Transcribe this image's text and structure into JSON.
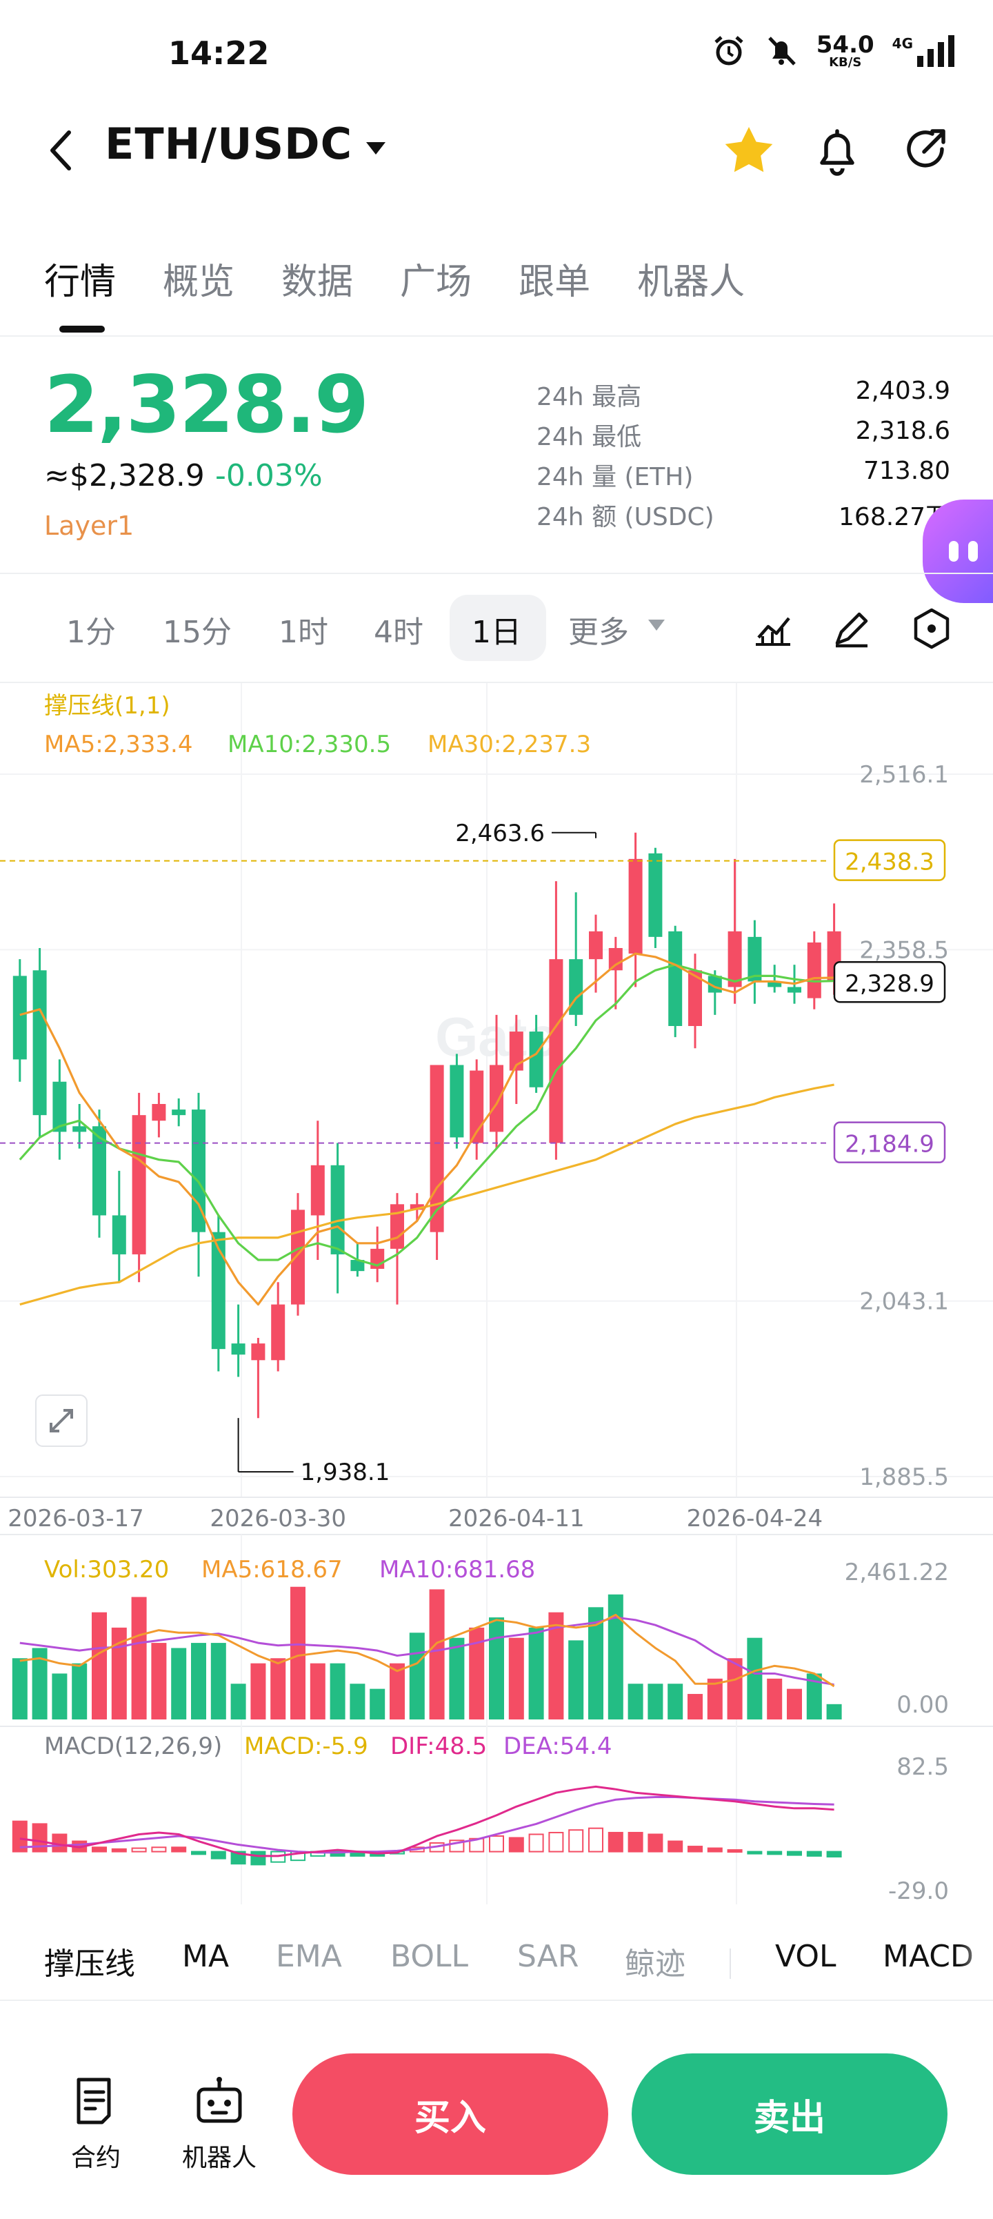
{
  "status_bar": {
    "time": "14:22",
    "net_speed": "54.0",
    "net_unit": "KB/S",
    "network": "4G"
  },
  "header": {
    "pair": "ETH/USDC",
    "favorited": true
  },
  "tabs": [
    {
      "label": "行情",
      "active": true
    },
    {
      "label": "概览",
      "active": false
    },
    {
      "label": "数据",
      "active": false
    },
    {
      "label": "广场",
      "active": false
    },
    {
      "label": "跟单",
      "active": false
    },
    {
      "label": "机器人",
      "active": false
    }
  ],
  "price": {
    "last": "2,328.9",
    "usd": "≈$2,328.9",
    "change": "-0.03%",
    "tag": "Layer1"
  },
  "stats": [
    {
      "label": "24h  最高",
      "value": "2,403.9"
    },
    {
      "label": "24h  最低",
      "value": "2,318.6"
    },
    {
      "label": "24h  量 (ETH)",
      "value": "713.80"
    },
    {
      "label": "24h  额 (USDC)",
      "value": "168.27万"
    }
  ],
  "timeframes": [
    {
      "label": "1分",
      "active": false
    },
    {
      "label": "15分",
      "active": false
    },
    {
      "label": "1时",
      "active": false
    },
    {
      "label": "4时",
      "active": false
    },
    {
      "label": "1日",
      "active": true
    }
  ],
  "more_label": "更多",
  "colors": {
    "up": "#f44d64",
    "down": "#23bd84",
    "price_green": "#1fb77a",
    "ma5": "#f29a2e",
    "ma10": "#5ed14a",
    "ma30": "#f2b42a",
    "vol_ma10": "#b44fd8",
    "support": "#9b4dc4",
    "resistance": "#e0b400"
  },
  "chart_data": [
    {
      "type": "candlestick",
      "legend": {
        "sr": "撑压线(1,1)",
        "ma5": "MA5:2,333.4",
        "ma10": "MA10:2,330.5",
        "ma30": "MA30:2,237.3"
      },
      "y_ticks": [
        "2,516.1",
        "2,358.5",
        "2,043.1",
        "1,885.5"
      ],
      "y_tick_values": [
        2516.1,
        2358.5,
        2043.1,
        1885.5
      ],
      "ylim": [
        1885.5,
        2516.1
      ],
      "x_labels": [
        "2026-03-17",
        "2026-03-30",
        "2026-04-11",
        "2026-04-24"
      ],
      "x_label_index": [
        0,
        13,
        25,
        37
      ],
      "current_price": "2,328.9",
      "current_value": 2328.9,
      "resistance": "2,438.3",
      "resistance_value": 2438.3,
      "support": "2,184.9",
      "support_value": 2184.9,
      "max_label": "2,463.6",
      "max_index": 29,
      "max_value": 2463.6,
      "min_label": "1,938.1",
      "min_index": 11,
      "min_value": 1938.1,
      "first_index": -1,
      "candles": [
        [
          2335,
          2350,
          2240,
          2260
        ],
        [
          2340,
          2360,
          2190,
          2210
        ],
        [
          2240,
          2260,
          2170,
          2195
        ],
        [
          2200,
          2220,
          2180,
          2195
        ],
        [
          2200,
          2215,
          2100,
          2120
        ],
        [
          2120,
          2160,
          2060,
          2085
        ],
        [
          2085,
          2230,
          2060,
          2210
        ],
        [
          2205,
          2230,
          2190,
          2220
        ],
        [
          2215,
          2225,
          2200,
          2210
        ],
        [
          2215,
          2230,
          2065,
          2105
        ],
        [
          2105,
          2120,
          1980,
          2000
        ],
        [
          2005,
          2040,
          1975,
          1995
        ],
        [
          1990,
          2010,
          1938,
          2005
        ],
        [
          1990,
          2060,
          1980,
          2040
        ],
        [
          2040,
          2140,
          2030,
          2125
        ],
        [
          2120,
          2205,
          2080,
          2165
        ],
        [
          2165,
          2185,
          2050,
          2085
        ],
        [
          2080,
          2095,
          2065,
          2070
        ],
        [
          2072,
          2110,
          2060,
          2090
        ],
        [
          2090,
          2140,
          2040,
          2130
        ],
        [
          2125,
          2140,
          2115,
          2130
        ],
        [
          2105,
          2250,
          2080,
          2255
        ],
        [
          2255,
          2265,
          2180,
          2190
        ],
        [
          2185,
          2260,
          2170,
          2250
        ],
        [
          2195,
          2300,
          2180,
          2255
        ],
        [
          2250,
          2300,
          2220,
          2285
        ],
        [
          2285,
          2300,
          2230,
          2235
        ],
        [
          2185,
          2420,
          2170,
          2350
        ],
        [
          2350,
          2410,
          2290,
          2300
        ],
        [
          2350,
          2390,
          2320,
          2375
        ],
        [
          2340,
          2370,
          2305,
          2360
        ],
        [
          2355,
          2463.6,
          2325,
          2440
        ],
        [
          2445,
          2450,
          2360,
          2370
        ],
        [
          2375,
          2380,
          2280,
          2290
        ],
        [
          2290,
          2355,
          2270,
          2340
        ],
        [
          2335,
          2340,
          2300,
          2320
        ],
        [
          2325,
          2440,
          2310,
          2375
        ],
        [
          2370,
          2385,
          2310,
          2330
        ],
        [
          2330,
          2345,
          2320,
          2325
        ],
        [
          2325,
          2345,
          2310,
          2320
        ],
        [
          2315,
          2375,
          2305,
          2365
        ],
        [
          2330,
          2400,
          2318,
          2375
        ]
      ],
      "ma5_line": [
        2300,
        2305,
        2270,
        2230,
        2205,
        2180,
        2170,
        2155,
        2150,
        2130,
        2090,
        2060,
        2040,
        2065,
        2085,
        2105,
        2110,
        2095,
        2095,
        2100,
        2115,
        2145,
        2165,
        2195,
        2220,
        2255,
        2265,
        2290,
        2315,
        2330,
        2345,
        2355,
        2352,
        2345,
        2335,
        2325,
        2320,
        2330,
        2330,
        2328,
        2333,
        2333.4
      ],
      "ma10_line": [
        2170,
        2190,
        2200,
        2205,
        2190,
        2180,
        2175,
        2170,
        2168,
        2150,
        2120,
        2095,
        2080,
        2080,
        2090,
        2095,
        2090,
        2080,
        2075,
        2085,
        2100,
        2125,
        2140,
        2160,
        2180,
        2200,
        2215,
        2250,
        2270,
        2295,
        2310,
        2330,
        2340,
        2345,
        2340,
        2335,
        2330,
        2335,
        2335,
        2332,
        2330,
        2330.5
      ],
      "ma30_line": [
        2040,
        2045,
        2050,
        2055,
        2058,
        2060,
        2070,
        2080,
        2090,
        2095,
        2098,
        2100,
        2100,
        2100,
        2105,
        2110,
        2115,
        2118,
        2120,
        2122,
        2126,
        2130,
        2135,
        2140,
        2145,
        2150,
        2155,
        2160,
        2165,
        2170,
        2178,
        2186,
        2194,
        2202,
        2208,
        2212,
        2216,
        2220,
        2226,
        2230,
        2234,
        2237.3
      ]
    },
    {
      "type": "bar",
      "legend": {
        "vol": "Vol:303.20",
        "ma5": "MA5:618.67",
        "ma10": "MA10:681.68"
      },
      "y_ticks": [
        "2,461.22",
        "0.00"
      ],
      "ylim": [
        0,
        2461.22
      ],
      "values": [
        1200,
        1400,
        900,
        1100,
        2100,
        1800,
        2400,
        1500,
        1400,
        1500,
        1500,
        700,
        1100,
        1200,
        2600,
        1100,
        1100,
        700,
        600,
        1100,
        1700,
        2550,
        1600,
        1800,
        2000,
        1600,
        1800,
        2100,
        1550,
        2200,
        2450,
        700,
        700,
        700,
        500,
        800,
        1200,
        1600,
        800,
        600,
        900,
        300
      ],
      "up": [
        false,
        false,
        false,
        false,
        true,
        true,
        true,
        true,
        false,
        false,
        false,
        false,
        true,
        true,
        true,
        true,
        false,
        false,
        false,
        true,
        false,
        true,
        false,
        true,
        false,
        true,
        false,
        true,
        false,
        false,
        false,
        false,
        false,
        false,
        true,
        true,
        true,
        false,
        true,
        true,
        false,
        false
      ],
      "ma5_line": [
        1150,
        1200,
        1100,
        1050,
        1300,
        1500,
        1650,
        1750,
        1700,
        1700,
        1650,
        1450,
        1250,
        1100,
        1250,
        1300,
        1350,
        1300,
        1150,
        950,
        1100,
        1500,
        1650,
        1800,
        1950,
        1900,
        1800,
        1850,
        1800,
        1850,
        2050,
        1700,
        1400,
        1150,
        700,
        700,
        780,
        950,
        1050,
        1000,
        900,
        650
      ],
      "ma10_line": [
        1500,
        1450,
        1400,
        1350,
        1400,
        1420,
        1500,
        1550,
        1600,
        1650,
        1680,
        1600,
        1500,
        1450,
        1470,
        1450,
        1430,
        1400,
        1350,
        1250,
        1300,
        1350,
        1420,
        1500,
        1600,
        1650,
        1700,
        1800,
        1850,
        1900,
        2000,
        1950,
        1850,
        1700,
        1550,
        1300,
        1100,
        900,
        900,
        820,
        750,
        682
      ]
    },
    {
      "type": "bar",
      "legend": {
        "macd": "MACD(12,26,9)",
        "macd_val": "MACD:-5.9",
        "dif": "DIF:48.5",
        "dea": "DEA:54.4"
      },
      "y_ticks": [
        "82.5",
        "-29.0"
      ],
      "ylim": [
        -29.0,
        82.5
      ],
      "hist": [
        35,
        32,
        20,
        12,
        5,
        3,
        4,
        5,
        5,
        -3,
        -8,
        -14,
        -15,
        -12,
        -10,
        -5,
        -5,
        -5,
        -5,
        -2,
        5,
        10,
        13,
        15,
        18,
        16,
        20,
        22,
        25,
        27,
        22,
        22,
        20,
        12,
        6,
        4,
        2,
        -2,
        -3,
        -4,
        -5,
        -5.9
      ],
      "dif": [
        15,
        12,
        8,
        5,
        10,
        15,
        20,
        22,
        20,
        12,
        5,
        -2,
        -5,
        -5,
        -2,
        0,
        2,
        0,
        -2,
        -1,
        8,
        18,
        25,
        33,
        42,
        52,
        60,
        68,
        72,
        75,
        72,
        68,
        66,
        64,
        62,
        60,
        58,
        55,
        52,
        50,
        50,
        48.5
      ],
      "dea": [
        5,
        6,
        7,
        8,
        10,
        12,
        14,
        16,
        18,
        16,
        12,
        8,
        5,
        2,
        0,
        -1,
        -1,
        0,
        0,
        1,
        3,
        6,
        10,
        14,
        20,
        26,
        32,
        40,
        48,
        55,
        60,
        62,
        63,
        63,
        62,
        61,
        60,
        58,
        57,
        56,
        55,
        54.4
      ]
    }
  ],
  "indicator_tabs": [
    {
      "label": "撑压线",
      "active": true
    },
    {
      "label": "MA",
      "active": true
    },
    {
      "label": "EMA",
      "active": false
    },
    {
      "label": "BOLL",
      "active": false
    },
    {
      "label": "SAR",
      "active": false
    },
    {
      "label": "鲸迹",
      "active": false
    },
    {
      "label": "VOL",
      "active": true
    },
    {
      "label": "MACD",
      "active": true
    }
  ],
  "bottom_bar": {
    "contract_label": "合约",
    "robot_label": "机器人",
    "buy_label": "买入",
    "sell_label": "卖出"
  },
  "icons": [
    "back-arrow-icon",
    "caret-down-icon",
    "star-icon",
    "bell-icon",
    "share-icon",
    "alarm-icon",
    "bell-off-icon",
    "signal-icon",
    "indicator-icon",
    "pen-icon",
    "hexagon-icon",
    "expand-icon",
    "contract-icon",
    "robot-icon"
  ]
}
